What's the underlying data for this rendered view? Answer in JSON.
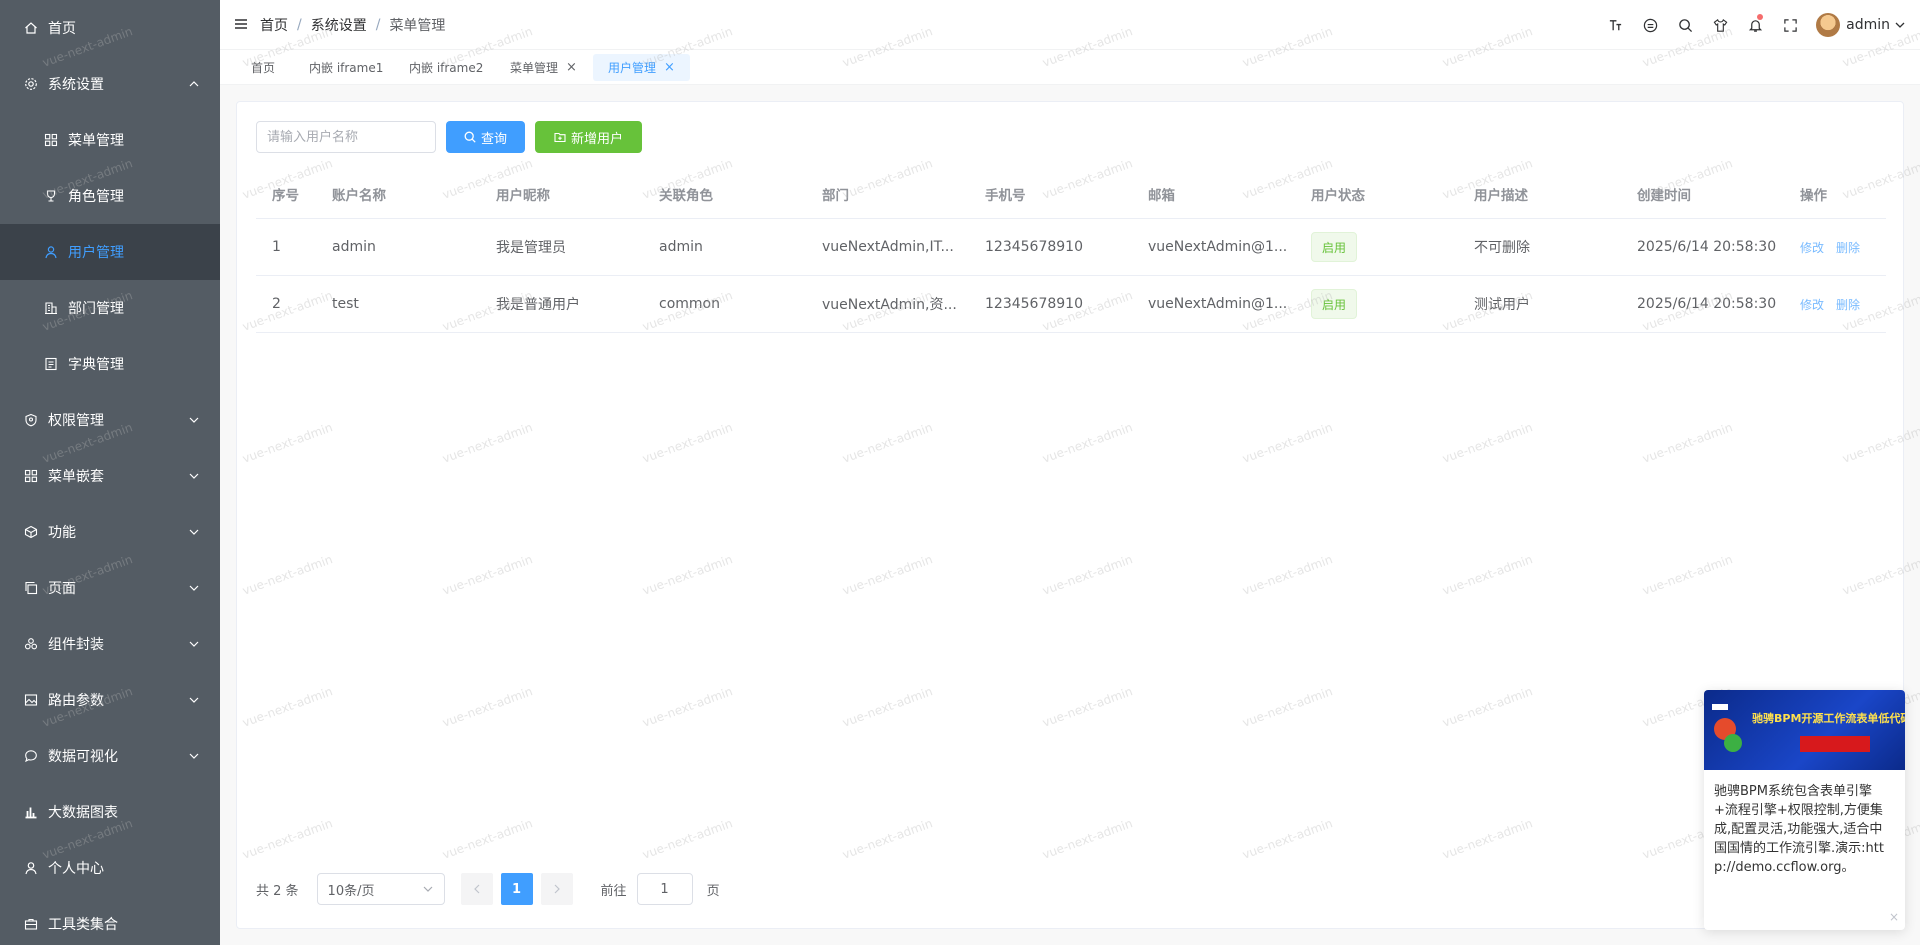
{
  "sidebar": {
    "items": [
      {
        "label": "首页",
        "icon": "home-icon",
        "level": 0,
        "expandable": false
      },
      {
        "label": "系统设置",
        "icon": "gear-icon",
        "level": 0,
        "expandable": true,
        "expanded": true
      },
      {
        "label": "菜单管理",
        "icon": "grid-icon",
        "level": 1,
        "expandable": false
      },
      {
        "label": "角色管理",
        "icon": "trophy-icon",
        "level": 1,
        "expandable": false
      },
      {
        "label": "用户管理",
        "icon": "user-icon",
        "level": 1,
        "expandable": false,
        "active": true
      },
      {
        "label": "部门管理",
        "icon": "building-icon",
        "level": 1,
        "expandable": false
      },
      {
        "label": "字典管理",
        "icon": "document-icon",
        "level": 1,
        "expandable": false
      },
      {
        "label": "权限管理",
        "icon": "shield-icon",
        "level": 0,
        "expandable": true
      },
      {
        "label": "菜单嵌套",
        "icon": "grid-icon",
        "level": 0,
        "expandable": true
      },
      {
        "label": "功能",
        "icon": "box-icon",
        "level": 0,
        "expandable": true
      },
      {
        "label": "页面",
        "icon": "copy-icon",
        "level": 0,
        "expandable": true
      },
      {
        "label": "组件封装",
        "icon": "components-icon",
        "level": 0,
        "expandable": true
      },
      {
        "label": "路由参数",
        "icon": "picture-icon",
        "level": 0,
        "expandable": true
      },
      {
        "label": "数据可视化",
        "icon": "chat-icon",
        "level": 0,
        "expandable": true
      },
      {
        "label": "大数据图表",
        "icon": "bar-chart-icon",
        "level": 0,
        "expandable": false
      },
      {
        "label": "个人中心",
        "icon": "person-icon",
        "level": 0,
        "expandable": false
      },
      {
        "label": "工具类集合",
        "icon": "briefcase-icon",
        "level": 0,
        "expandable": false
      }
    ]
  },
  "header": {
    "breadcrumb": [
      "首页",
      "系统设置",
      "菜单管理"
    ],
    "user_name": "admin",
    "icons": [
      "font-size-icon",
      "palette-icon",
      "search-icon",
      "shirt-icon",
      "bell-icon",
      "fullscreen-icon"
    ]
  },
  "tags": [
    {
      "label": "首页",
      "closable": false
    },
    {
      "label": "内嵌 iframe1",
      "closable": false
    },
    {
      "label": "内嵌 iframe2",
      "closable": false
    },
    {
      "label": "菜单管理",
      "closable": true
    },
    {
      "label": "用户管理",
      "closable": true,
      "active": true
    }
  ],
  "toolbar": {
    "search_placeholder": "请输入用户名称",
    "query_label": "查询",
    "add_label": "新增用户"
  },
  "table": {
    "columns": [
      "序号",
      "账户名称",
      "用户昵称",
      "关联角色",
      "部门",
      "手机号",
      "邮箱",
      "用户状态",
      "用户描述",
      "创建时间",
      "操作"
    ],
    "rows": [
      {
        "index": "1",
        "account": "admin",
        "nickname": "我是管理员",
        "role": "admin",
        "dept": "vueNextAdmin,IT...",
        "phone": "12345678910",
        "email": "vueNextAdmin@1...",
        "status": "启用",
        "desc": "不可删除",
        "created": "2025/6/14 20:58:30",
        "edit": "修改",
        "delete": "删除"
      },
      {
        "index": "2",
        "account": "test",
        "nickname": "我是普通用户",
        "role": "common",
        "dept": "vueNextAdmin,资...",
        "phone": "12345678910",
        "email": "vueNextAdmin@1...",
        "status": "启用",
        "desc": "测试用户",
        "created": "2025/6/14 20:58:30",
        "edit": "修改",
        "delete": "删除"
      }
    ]
  },
  "pagination": {
    "total_text": "共 2 条",
    "page_size": "10条/页",
    "current_page": "1",
    "goto_label": "前往",
    "goto_value": "1",
    "page_unit": "页"
  },
  "ad": {
    "banner_title": "驰骋BPM开源工作流表单低代码开发平台",
    "text": "驰骋BPM系统包含表单引擎+流程引擎+权限控制,方便集成,配置灵活,功能强大,适合中国国情的工作流引擎.演示:http://demo.ccflow.org。",
    "close": "×"
  },
  "watermark": "vue-next-admin",
  "colors": {
    "sidebar_bg": "#545c64",
    "primary": "#409eff",
    "success": "#67c23a",
    "danger": "#f56c6c"
  }
}
